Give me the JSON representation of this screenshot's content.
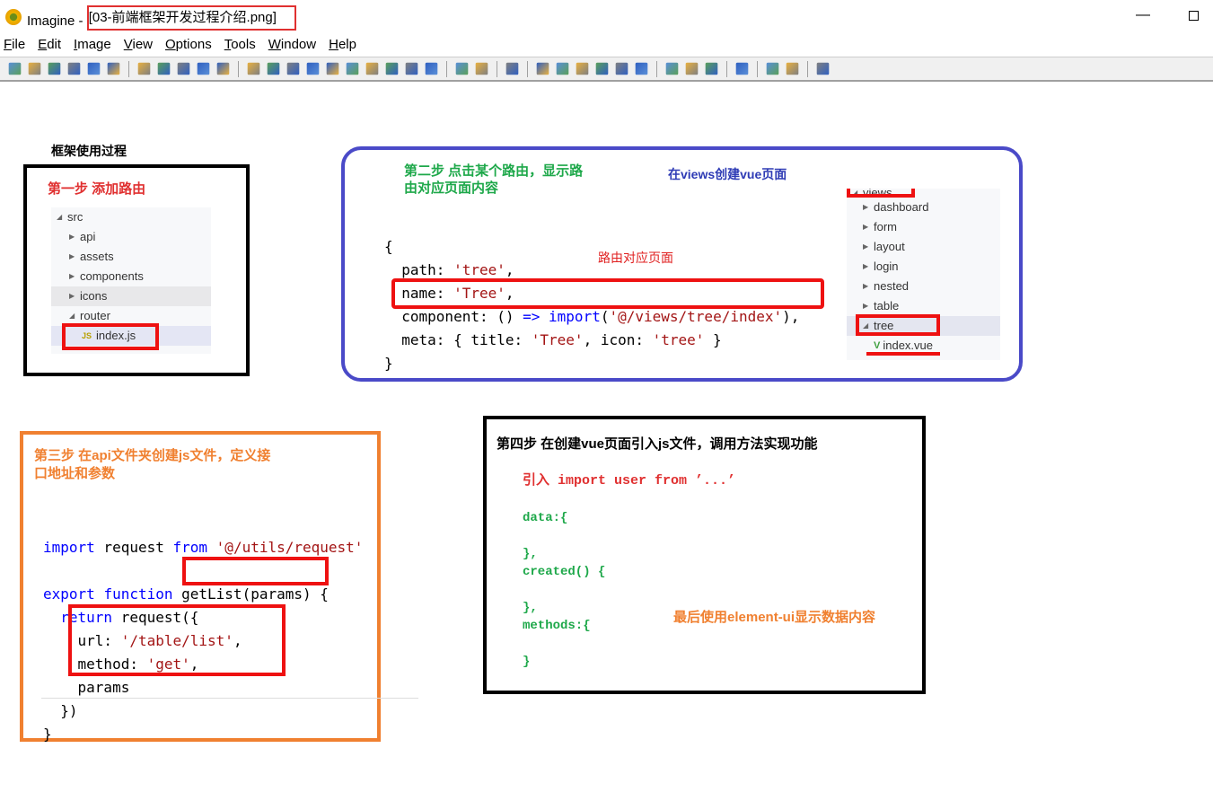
{
  "window": {
    "app": "Imagine - ",
    "file": "[03-前端框架开发过程介绍.png]",
    "minimize": "—"
  },
  "menu": [
    {
      "u": "F",
      "rest": "ile"
    },
    {
      "u": "E",
      "rest": "dit"
    },
    {
      "u": "I",
      "rest": "mage"
    },
    {
      "u": "V",
      "rest": "iew"
    },
    {
      "u": "O",
      "rest": "ptions"
    },
    {
      "u": "T",
      "rest": "ools"
    },
    {
      "u": "W",
      "rest": "indow"
    },
    {
      "u": "H",
      "rest": "elp"
    }
  ],
  "toolbar_icons": [
    "new",
    "open",
    "save",
    "print",
    "prev",
    "next",
    "|",
    "cut",
    "copy",
    "paste",
    "undo",
    "redo",
    "|",
    "info",
    "camera",
    "resize",
    "flip",
    "grayscale",
    "frame",
    "color",
    "down",
    "rotate",
    "filter",
    "|",
    "page-left",
    "page-right",
    "|",
    "paint",
    "|",
    "zoom-in",
    "zoom-out",
    "magic",
    "fit",
    "actual",
    "full",
    "|",
    "monitor",
    "slideshow",
    "crop",
    "|",
    "wrench",
    "|",
    "convert",
    "batch",
    "|",
    "help"
  ],
  "content": {
    "title": "框架使用过程",
    "step1": {
      "heading": "第一步  添加路由",
      "tree": [
        {
          "label": "src",
          "open": true,
          "level": 0
        },
        {
          "label": "api",
          "level": 1
        },
        {
          "label": "assets",
          "level": 1
        },
        {
          "label": "components",
          "level": 1
        },
        {
          "label": "icons",
          "level": 1,
          "hl": true
        },
        {
          "label": "router",
          "open": true,
          "level": 1
        },
        {
          "label": "index.js",
          "level": 2,
          "file": "JS",
          "sel": true
        }
      ]
    },
    "step2": {
      "heading1": "第二步  点击某个路由，显示路",
      "heading2": "由对应页面内容",
      "note_views": "在views创建vue页面",
      "note_route": "路由对应页面",
      "code": {
        "l1": "{",
        "l2a": "  path: ",
        "l2b": "'tree'",
        "l2c": ",",
        "l3a": "  name: ",
        "l3b": "'Tree'",
        "l3c": ",",
        "l4a": "  component: () ",
        "l4b": "=>",
        "l4c": " ",
        "l4d": "import",
        "l4e": "(",
        "l4f": "'@/views/tree/index'",
        "l4g": "),",
        "l5a": "  meta: { title: ",
        "l5b": "'Tree'",
        "l5c": ", icon: ",
        "l5d": "'tree'",
        "l5e": " }",
        "l6": "}"
      },
      "tree": [
        "views",
        "dashboard",
        "form",
        "layout",
        "login",
        "nested",
        "table",
        "tree",
        "index.vue"
      ]
    },
    "step3": {
      "heading1": "第三步  在api文件夹创建js文件，定义接",
      "heading2": "口地址和参数",
      "code": {
        "a1": "import",
        "a2": " request ",
        "a3": "from",
        "a4": " ",
        "a5": "'@/utils/request'",
        "b1": "export",
        "b2": " ",
        "b3": "function",
        "b4": " getList(params) {",
        "c1": "  ",
        "c2": "return",
        "c3": " request({",
        "d1": "    url: ",
        "d2": "'/table/list'",
        "d3": ",",
        "e1": "    method: ",
        "e2": "'get'",
        "e3": ",",
        "f": "    params",
        "g": "  })",
        "h": "}"
      }
    },
    "step4": {
      "heading": "第四步  在创建vue页面引入js文件，调用方法实现功能",
      "import": "引入 import user from ’...’",
      "lines": [
        "data:{",
        "",
        "},",
        "created()  {",
        "",
        "},",
        "methods:{",
        "",
        "}"
      ],
      "note": "最后使用element-ui显示数据内容"
    }
  },
  "colors": {
    "red": "#ee1111",
    "blue_box": "#4a4ac8",
    "orange_box": "#f08030",
    "green": "#1ea84a",
    "step1_red": "#e03030"
  }
}
